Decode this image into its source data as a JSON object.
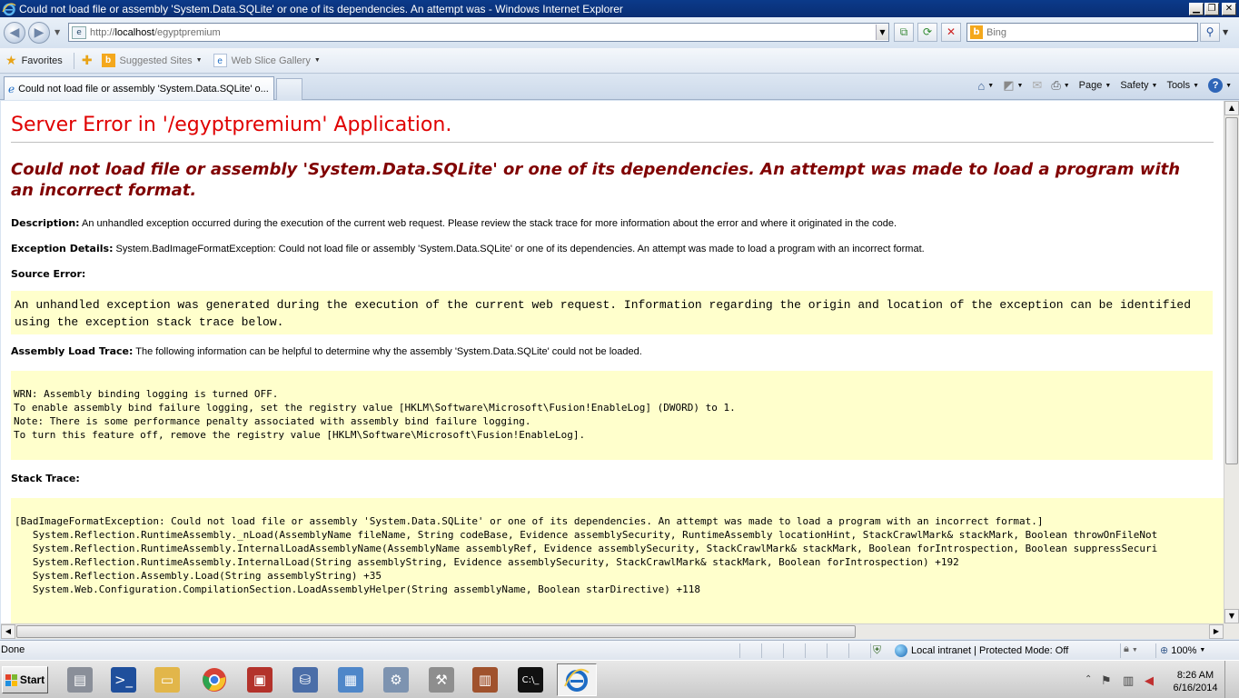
{
  "window": {
    "title": "Could not load file or assembly 'System.Data.SQLite' or one of its dependencies. An attempt was - Windows Internet Explorer",
    "min_glyph": "▁",
    "restore_glyph": "❐",
    "close_glyph": "✕"
  },
  "address_bar": {
    "url_prefix": "http://",
    "url_host": "localhost",
    "url_path": "/egyptpremium",
    "search_placeholder": "Bing"
  },
  "favorites_bar": {
    "favorites_label": "Favorites",
    "links": [
      {
        "label": "Suggested Sites",
        "icon": "bing-icon"
      },
      {
        "label": "Web Slice Gallery",
        "icon": "ie-page-icon"
      }
    ]
  },
  "tabs": [
    {
      "label": "Could not load file or assembly 'System.Data.SQLite' o..."
    }
  ],
  "command_bar": {
    "page_label": "Page",
    "safety_label": "Safety",
    "tools_label": "Tools"
  },
  "page": {
    "server_error_title": "Server Error in '/egyptpremium' Application.",
    "error_message": "Could not load file or assembly 'System.Data.SQLite' or one of its dependencies. An attempt was made to load a program with an incorrect format.",
    "description_label": "Description:",
    "description_text": " An unhandled exception occurred during the execution of the current web request. Please review the stack trace for more information about the error and where it originated in the code.",
    "exception_label": "Exception Details:",
    "exception_text": " System.BadImageFormatException: Could not load file or assembly 'System.Data.SQLite' or one of its dependencies. An attempt was made to load a program with an incorrect format.",
    "source_error_label": "Source Error:",
    "source_error_text": "An unhandled exception was generated during the execution of the current web request. Information regarding the origin and location of the exception can be identified using the exception stack trace below.",
    "assembly_trace_label": "Assembly Load Trace:",
    "assembly_trace_intro": " The following information can be helpful to determine why the assembly 'System.Data.SQLite' could not be loaded.",
    "assembly_trace_lines": "WRN: Assembly binding logging is turned OFF.\nTo enable assembly bind failure logging, set the registry value [HKLM\\Software\\Microsoft\\Fusion!EnableLog] (DWORD) to 1.\nNote: There is some performance penalty associated with assembly bind failure logging.\nTo turn this feature off, remove the registry value [HKLM\\Software\\Microsoft\\Fusion!EnableLog].",
    "stack_trace_label": "Stack Trace:",
    "stack_trace_lines": "[BadImageFormatException: Could not load file or assembly 'System.Data.SQLite' or one of its dependencies. An attempt was made to load a program with an incorrect format.]\n   System.Reflection.RuntimeAssembly._nLoad(AssemblyName fileName, String codeBase, Evidence assemblySecurity, RuntimeAssembly locationHint, StackCrawlMark& stackMark, Boolean throwOnFileNot\n   System.Reflection.RuntimeAssembly.InternalLoadAssemblyName(AssemblyName assemblyRef, Evidence assemblySecurity, StackCrawlMark& stackMark, Boolean forIntrospection, Boolean suppressSecuri\n   System.Reflection.RuntimeAssembly.InternalLoad(String assemblyString, Evidence assemblySecurity, StackCrawlMark& stackMark, Boolean forIntrospection) +192\n   System.Reflection.Assembly.Load(String assemblyString) +35\n   System.Web.Configuration.CompilationSection.LoadAssemblyHelper(String assemblyName, Boolean starDirective) +118"
  },
  "status_bar": {
    "status_text": "Done",
    "zone_text": "Local intranet | Protected Mode: Off",
    "zoom_text": "100%"
  },
  "taskbar": {
    "start_label": "Start",
    "apps": [
      {
        "icon": "server-manager-icon",
        "color": "#8a8f99"
      },
      {
        "icon": "powershell-icon",
        "color": "#1f4f9c"
      },
      {
        "icon": "explorer-folder-icon",
        "color": "#e2b64a"
      },
      {
        "icon": "chrome-icon",
        "color": "#d64235"
      },
      {
        "icon": "toolbox-icon",
        "color": "#b3322b"
      },
      {
        "icon": "sql-server-icon",
        "color": "#4b6ea8"
      },
      {
        "icon": "remote-desktop-icon",
        "color": "#4f87c9"
      },
      {
        "icon": "iis-manager-icon",
        "color": "#7d93b0"
      },
      {
        "icon": "tools-icon",
        "color": "#8e8e8e"
      },
      {
        "icon": "firewall-icon",
        "color": "#a0522d"
      },
      {
        "icon": "command-prompt-icon",
        "color": "#111111"
      },
      {
        "icon": "internet-explorer-icon",
        "color": "#1d6cc5"
      }
    ],
    "clock_time": "8:26 AM",
    "clock_date": "6/16/2014"
  },
  "colors": {
    "server_error_red": "#e00000",
    "error_message_maroon": "#800000",
    "code_background": "#ffffcc"
  }
}
